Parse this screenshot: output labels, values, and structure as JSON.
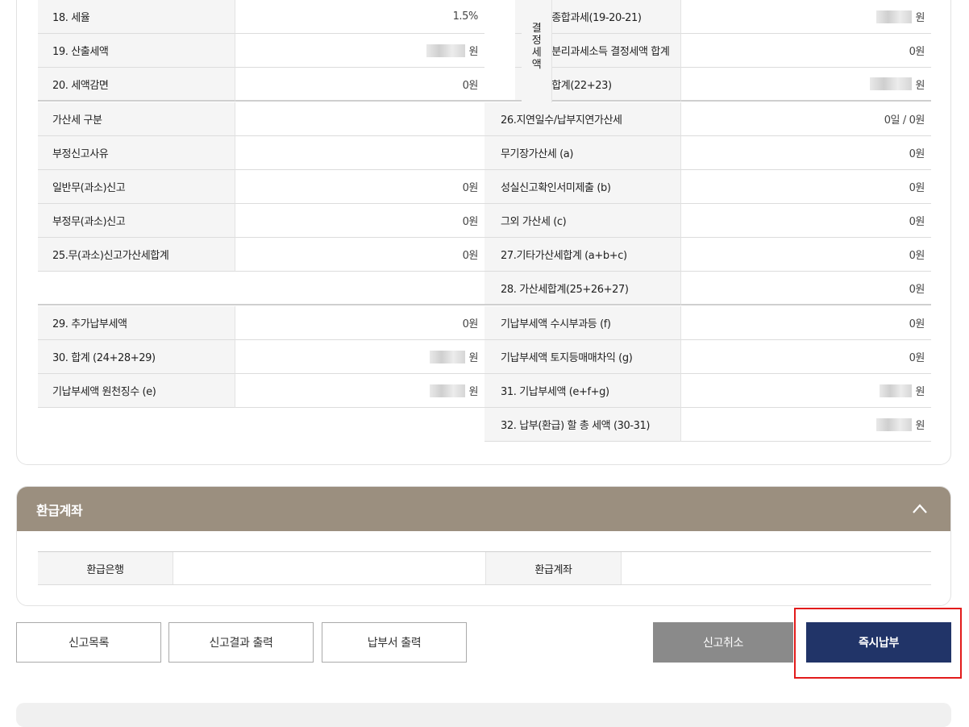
{
  "tax_section": {
    "rows": [
      {
        "l1": "18. 세율",
        "v1": "1.5%",
        "l2": "22. 종합과세(19-20-21)",
        "v2": "원"
      },
      {
        "l1": "19. 산출세액",
        "v1": "원",
        "l2": "23. 분리과세소득 결정세액 합계",
        "v2": "0원"
      },
      {
        "l1": "20. 세액감면",
        "v1": "0원",
        "l2": "24. 합계(22+23)",
        "v2": "원"
      },
      {
        "l1": "가산세 구분",
        "v1": "",
        "l2": "26.지연일수/납부지연가산세",
        "v2": "0일 / 0원"
      },
      {
        "l1": "부정신고사유",
        "v1": "",
        "l2": "무기장가산세 (a)",
        "v2": "0원"
      },
      {
        "l1": "일반무(과소)신고",
        "v1": "0원",
        "l2": "성실신고확인서미제출 (b)",
        "v2": "0원"
      },
      {
        "l1": "부정무(과소)신고",
        "v1": "0원",
        "l2": "그외 가산세 (c)",
        "v2": "0원"
      },
      {
        "l1": "25.무(과소)신고가산세합계",
        "v1": "0원",
        "l2": "27.기타가산세합계 (a+b+c)",
        "v2": "0원"
      },
      {
        "l1": "",
        "v1": "",
        "l2": "28. 가산세합계(25+26+27)",
        "v2": "0원"
      },
      {
        "l1": "29. 추가납부세액",
        "v1": "0원",
        "l2": "기납부세액 수시부과등 (f)",
        "v2": "0원"
      },
      {
        "l1": "30. 합계 (24+28+29)",
        "v1": "원",
        "l2": "기납부세액 토지등매매차익 (g)",
        "v2": "0원"
      },
      {
        "l1": "기납부세액 원천징수 (e)",
        "v1": "원",
        "l2": "31. 기납부세액 (e+f+g)",
        "v2": "원"
      },
      {
        "l1": "",
        "v1": "",
        "l2": "32. 납부(환급) 할 총 세액 (30-31)",
        "v2": "원"
      }
    ],
    "gyeoljeong_label": "결\n정\n세\n액"
  },
  "refund": {
    "title": "환급계좌",
    "bank_label": "환급은행",
    "bank_value": "",
    "account_label": "환급계좌",
    "account_value": ""
  },
  "buttons": {
    "list": "신고목록",
    "print_result": "신고결과 출력",
    "print_bill": "납부서 출력",
    "cancel": "신고취소",
    "pay_now": "즉시납부"
  },
  "colors": {
    "refund_header": "#9b8f7f",
    "pay_button": "#213468",
    "cancel_button": "#8a8a8a",
    "highlight_border": "#e21b1b"
  }
}
